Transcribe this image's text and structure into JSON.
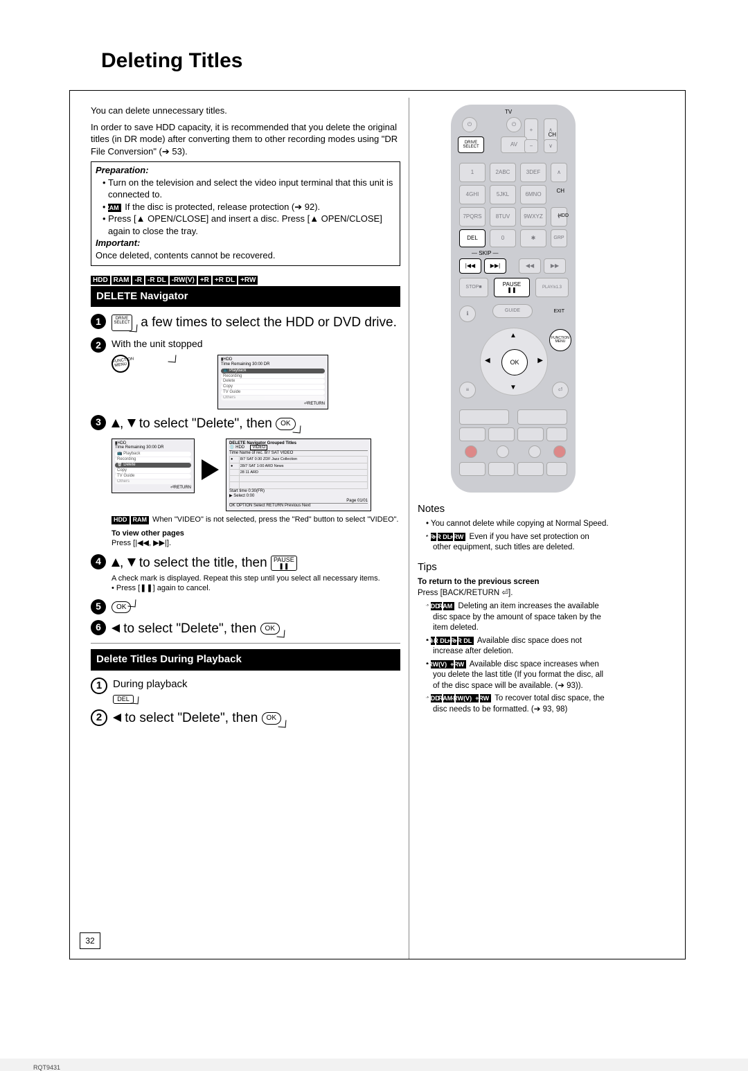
{
  "page": {
    "title": "Deleting Titles",
    "number": "32",
    "docId": "RQT9431"
  },
  "intro": {
    "l1": "You can delete unnecessary titles.",
    "l2": "In order to save HDD capacity, it is recommended that you delete the original titles (in DR mode) after converting them to other recording modes using \"DR File Conversion\" (➔  53)."
  },
  "prep": {
    "hdr": "Preparation:",
    "b1": "Turn on the television and select the video input terminal that this unit is connected to.",
    "b2_pre": "RAM",
    "b2": " If the disc is protected, release protection (➔ 92).",
    "b3": "Press [▲ OPEN/CLOSE] and insert a disc. Press [▲ OPEN/CLOSE] again to close the tray."
  },
  "important": {
    "hdr": "Important:",
    "txt": "Once deleted, contents cannot be recovered."
  },
  "media": {
    "tags": [
      "HDD",
      "RAM",
      "-R",
      "-R DL",
      "-RW(V)",
      "+R",
      "+R DL",
      "+RW"
    ]
  },
  "navHeader": "DELETE Navigator",
  "steps": {
    "s1": {
      "driveSelect": "DRIVE SELECT",
      "txt": " a few times to select the HDD or DVD drive."
    },
    "s2": {
      "txt": "With the unit stopped",
      "func": "FUNCTION MENU"
    },
    "screen1": {
      "hdd": "HDD",
      "time": "Time Remaining   30:00 DR",
      "items": [
        "Playback",
        "Recording",
        "Delete",
        "Copy",
        "TV Guide",
        "Others"
      ],
      "ret": "RETURN"
    },
    "s3": {
      "txt": " to select \"Delete\", then "
    },
    "screen2a": {
      "hdd": "HDD",
      "time": "Time Remaining   30:00 DR",
      "items": [
        "Playback",
        "Recording",
        "Delete",
        "Copy",
        "TV Guide",
        "Others"
      ],
      "ret": "RETURN"
    },
    "screen2b": {
      "title": "DELETE Navigator  Grouped Titles",
      "hdd": "HDD",
      "video": "VIDEO",
      "cols": "Time   Name of rec.   8/7 SAT   VIDEO",
      "r1": "8/7 SAT 0:30 ZDF   Jazz Collection",
      "r2": "28/7 SAT 1:00 ARD   News",
      "r3": "28 11  ARD",
      "startTime": "Start time   0:30(FR)",
      "select": "Select   0:00",
      "page": "Page 01/01",
      "foot": "OK   OPTION   Select   RETURN   Previous   Next"
    },
    "note3_pre": [
      "HDD",
      "RAM"
    ],
    "note3": " When \"VIDEO\" is not selected, press the \"Red\" button to select \"VIDEO\".",
    "viewOther": {
      "hd": "To view other pages",
      "tx": "Press [|◀◀, ▶▶|]."
    },
    "s4": {
      "txt": " to select the title, then ",
      "pause": "PAUSE",
      "note1": "A check mark is displayed. Repeat this step until you select all necessary items.",
      "note2": "Press [❚❚] again to cancel."
    },
    "s6": {
      "txt": " to select \"Delete\", then "
    }
  },
  "playbackHeader": "Delete Titles During Playback",
  "pb": {
    "s1": {
      "txt": "During playback",
      "del": "DEL"
    },
    "s2": {
      "txt": " to select \"Delete\", then "
    }
  },
  "remote": {
    "driveSelect": "DRIVE SELECT",
    "del": "DEL",
    "skip": "SKIP",
    "pause": "PAUSE",
    "ok": "OK",
    "func": "FUNCTION MENU",
    "tv": "TV",
    "av": "AV",
    "ch": "CH",
    "vol": [
      "+",
      "−"
    ],
    "stop": "STOP",
    "play": "PLAY/x1.3",
    "guide": "GUIDE",
    "exit": "EXIT",
    "numbers": [
      "1",
      "2ABC",
      "3DEF",
      "4GHI",
      "5JKL",
      "6MNO",
      "7PQRS",
      "8TUV",
      "9WXYZ",
      "0"
    ],
    "chArrows": [
      "∧",
      "∨"
    ],
    "hdd": "HDD"
  },
  "sidebar": {
    "notesHdr": "Notes",
    "notes": [
      {
        "txt": "You cannot delete while copying at Normal Speed."
      },
      {
        "tags": [
          "+R",
          "+R DL",
          "+RW"
        ],
        "txt": " Even if you have set protection on other equipment, such titles are deleted."
      }
    ],
    "tipsHdr": "Tips",
    "tipReturnHd": "To return to the previous screen",
    "tipReturnTx": "Press [BACK/RETURN ⏎].",
    "tips": [
      {
        "tags": [
          "HDD",
          "RAM"
        ],
        "txt": " Deleting an item increases the available disc space by the amount of space taken by the item deleted."
      },
      {
        "tags": [
          "-R",
          "-R DL",
          "+R",
          "+R DL"
        ],
        "txt": " Available disc space does not increase after deletion."
      },
      {
        "tags": [
          "-RW(V)",
          "+RW"
        ],
        "txt": " Available disc space increases when you delete the last title (If you format the disc, all of the disc space will be available. (➔ 93))."
      },
      {
        "tags": [
          "HDD",
          "RAM",
          "-RW(V)",
          "+RW"
        ],
        "txt": " To recover total disc space, the disc needs to be formatted. (➔ 93, 98)"
      }
    ]
  }
}
